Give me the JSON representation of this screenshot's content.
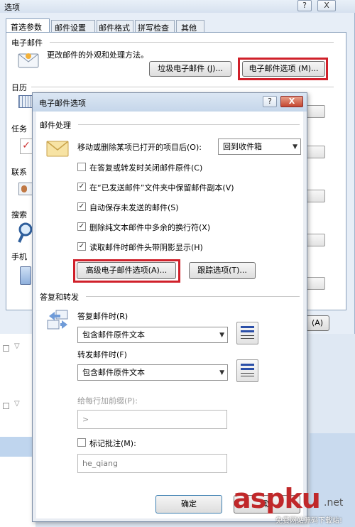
{
  "options_window": {
    "title": "选项",
    "help_button": "?",
    "close_button": "X",
    "tabs": [
      "首选参数",
      "邮件设置",
      "邮件格式",
      "拼写检查",
      "其他"
    ],
    "sections": {
      "mail": "电子邮件",
      "calendar": "日历",
      "tasks": "任务",
      "contacts": "联系",
      "search": "搜索",
      "mobile": "手机"
    },
    "mail_description": "更改邮件的外观和处理方法。",
    "junk_mail_button": "垃圾电子邮件 (J)...",
    "email_options_button": "电子邮件选项 (M)...",
    "apply_button": "(A)"
  },
  "dialog": {
    "title": "电子邮件选项",
    "help_button": "?",
    "close_button": "X",
    "handling": {
      "heading": "邮件处理",
      "move_delete_label": "移动或删除某项已打开的项目后(O):",
      "move_delete_value": "回到收件箱",
      "options": [
        {
          "label": "在答复或转发时关闭邮件原件(C)",
          "checked": false
        },
        {
          "label": "在“已发送邮件”文件夹中保留邮件副本(V)",
          "checked": true
        },
        {
          "label": "自动保存未发送的邮件(S)",
          "checked": true
        },
        {
          "label": "删除纯文本邮件中多余的换行符(X)",
          "checked": true
        },
        {
          "label": "读取邮件时邮件头带阴影显示(H)",
          "checked": true
        }
      ],
      "advanced_button": "高级电子邮件选项(A)...",
      "tracking_button": "跟踪选项(T)..."
    },
    "reply": {
      "heading": "答复和转发",
      "reply_label": "答复邮件时(R)",
      "reply_value": "包含邮件原件文本",
      "forward_label": "转发邮件时(F)",
      "forward_value": "包含邮件原件文本",
      "prefix_label": "给每行加前缀(P):",
      "prefix_value": ">",
      "mark_comments_label": "标记批注(M):",
      "mark_comments_checked": false,
      "comments_value": "he_qiang"
    },
    "ok_button": "确定",
    "cancel_button": "取"
  },
  "watermark": {
    "brand": "aspku",
    "tld": ".net",
    "subtitle": "免费网站源码下载站!",
    "brand_color": "#c0282a"
  }
}
